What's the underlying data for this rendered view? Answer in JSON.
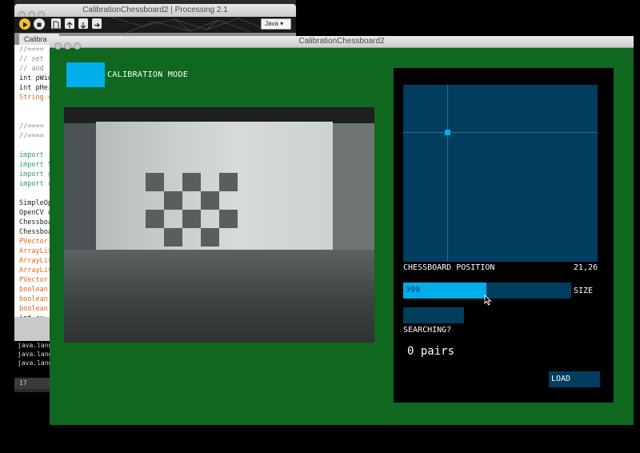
{
  "ide": {
    "title": "CalibrationChessboard2 | Processing 2.1",
    "mode": "Java",
    "tab": "Calibra",
    "code_lines": [
      {
        "text": "//====",
        "cls": "c-comment"
      },
      {
        "text": "// set",
        "cls": "c-comment"
      },
      {
        "text": "// and",
        "cls": "c-comment"
      },
      {
        "text": "int pWid",
        "cls": ""
      },
      {
        "text": "int pHei",
        "cls": ""
      },
      {
        "text": "String c",
        "cls": "c-type"
      },
      {
        "text": "",
        "cls": ""
      },
      {
        "text": "",
        "cls": ""
      },
      {
        "text": "//====",
        "cls": "c-comment"
      },
      {
        "text": "//====",
        "cls": "c-comment"
      },
      {
        "text": "",
        "cls": ""
      },
      {
        "text": "import ja",
        "cls": "c-kw"
      },
      {
        "text": "import S",
        "cls": "c-kw"
      },
      {
        "text": "import g",
        "cls": "c-kw"
      },
      {
        "text": "import c",
        "cls": "c-kw"
      },
      {
        "text": "",
        "cls": ""
      },
      {
        "text": "SimpleOp",
        "cls": ""
      },
      {
        "text": "OpenCV o",
        "cls": ""
      },
      {
        "text": "Chessboa",
        "cls": ""
      },
      {
        "text": "Chessboa",
        "cls": ""
      },
      {
        "text": "PVector[",
        "cls": "c-type"
      },
      {
        "text": "ArrayLis",
        "cls": "c-type"
      },
      {
        "text": "ArrayLis",
        "cls": "c-type"
      },
      {
        "text": "ArrayLis",
        "cls": "c-type"
      },
      {
        "text": "PVector ",
        "cls": "c-type"
      },
      {
        "text": "boolean ",
        "cls": "c-type"
      },
      {
        "text": "boolean ",
        "cls": "c-type"
      },
      {
        "text": "boolean ",
        "cls": "c-type"
      },
      {
        "text": "int cx, ",
        "cls": ""
      }
    ],
    "console_lines": [
      "java.lang",
      "java.lang",
      "java.lang"
    ],
    "line_number": "17"
  },
  "sketch": {
    "title": "CalibrationChessboard2",
    "mode_label": "CALIBRATION MODE",
    "position_label": "CHESSBOARD POSITION",
    "position_value": "21,26",
    "size_value": "399",
    "size_fraction": 0.495,
    "size_label": "SIZE",
    "searching_label": "SEARCHING?",
    "pairs_label": "0 pairs",
    "load_label": "LOAD"
  },
  "colors": {
    "background_green": "#0f6720",
    "accent": "#00aeea",
    "control_dark": "#013d5e"
  }
}
